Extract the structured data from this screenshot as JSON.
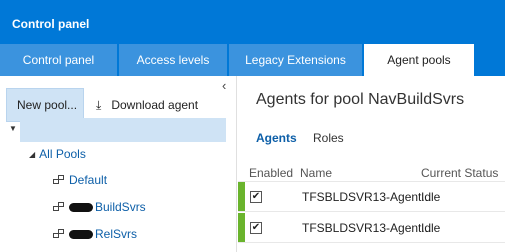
{
  "header": {
    "title": "Control panel"
  },
  "tabs": [
    {
      "label": "Control panel"
    },
    {
      "label": "Access levels"
    },
    {
      "label": "Legacy Extensions"
    },
    {
      "label": "Agent pools"
    }
  ],
  "active_tab": "Agent pools",
  "left_panel": {
    "collapse_glyph": "‹",
    "new_pool_label": "New pool...",
    "download_label": "Download agent",
    "download_icon": "download-icon",
    "tree": {
      "root_label": "All Pools",
      "pools": [
        {
          "label": "Default",
          "redacted_prefix": false,
          "selected": false
        },
        {
          "label": "BuildSvrs",
          "redacted_prefix": true,
          "selected": true
        },
        {
          "label": "RelSvrs",
          "redacted_prefix": true,
          "selected": false
        }
      ]
    }
  },
  "main": {
    "title": "Agents for pool NavBuildSvrs",
    "subtabs": [
      {
        "label": "Agents",
        "active": true
      },
      {
        "label": "Roles",
        "active": false
      }
    ],
    "columns": [
      "Enabled",
      "Name",
      "Current Status"
    ],
    "rows": [
      {
        "enabled": true,
        "name": "TFSBLDSVR13-Agent...",
        "status": "Idle"
      },
      {
        "enabled": true,
        "name": "TFSBLDSVR13-Agent...",
        "status": "Idle"
      }
    ]
  },
  "colors": {
    "header_blue": "#0078d7",
    "tab_blue": "#3b93de",
    "selection": "#cfe3f5",
    "online_green": "#6ab42d",
    "link_blue": "#0d5fa8"
  }
}
